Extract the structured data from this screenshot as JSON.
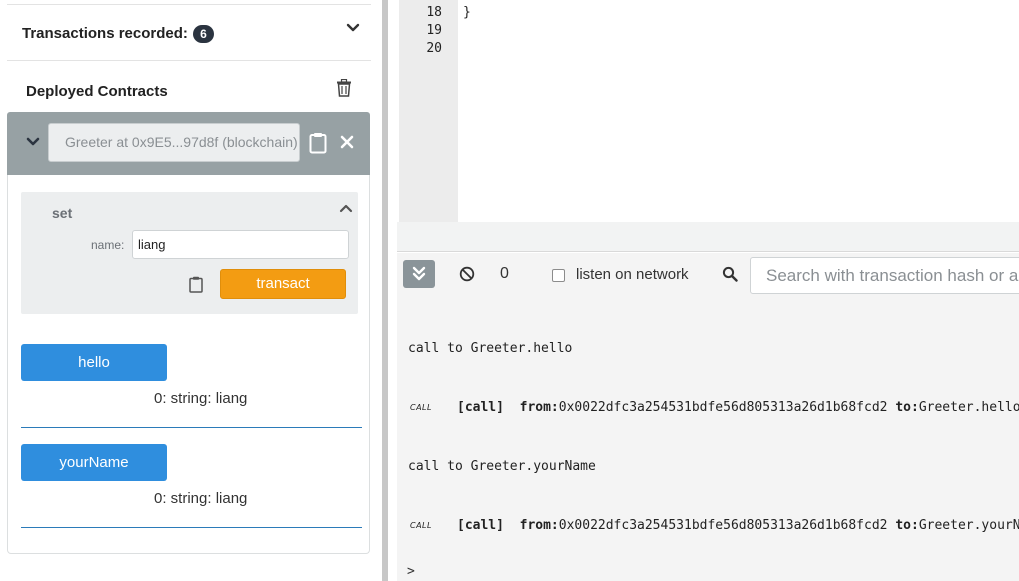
{
  "transactions": {
    "label": "Transactions recorded:",
    "count": "6"
  },
  "deployed": {
    "title": "Deployed Contracts",
    "instance_name": "Greeter at 0x9E5...97d8f (blockchain)",
    "set": {
      "title": "set",
      "param_label": "name:",
      "param_value": "liang",
      "transact_label": "transact"
    },
    "functions": [
      {
        "label": "hello",
        "output": "0: string: liang"
      },
      {
        "label": "yourName",
        "output": "0: string: liang"
      }
    ]
  },
  "editor": {
    "lines": [
      {
        "no": "18",
        "code": "}"
      },
      {
        "no": "19",
        "code": ""
      },
      {
        "no": "20",
        "code": ""
      }
    ]
  },
  "terminal": {
    "count": "0",
    "listen_label": "listen on network",
    "search_placeholder": "Search with transaction hash or address",
    "logs": [
      {
        "title": "call to Greeter.hello",
        "tag": "CALL",
        "kind": "[call]",
        "from_label": "from:",
        "from": "0x0022dfc3a254531bdfe56d805313a26d1b68fcd2",
        "to_label": "to:",
        "to": "Greeter.hello()"
      },
      {
        "title": "call to Greeter.yourName",
        "tag": "CALL",
        "kind": "[call]",
        "from_label": "from:",
        "from": "0x0022dfc3a254531bdfe56d805313a26d1b68fcd2",
        "to_label": "to:",
        "to": "Greeter.yourName()"
      }
    ],
    "prompt": ">"
  },
  "colors": {
    "transact": "#f39c12",
    "function_button": "#2f8ede",
    "instance_bar": "#97a1a4"
  },
  "icons": [
    "chevron-down-icon",
    "trash-icon",
    "clipboard-icon",
    "close-icon",
    "chevron-up-icon",
    "double-chevron-down-icon",
    "clear-icon",
    "search-icon"
  ]
}
